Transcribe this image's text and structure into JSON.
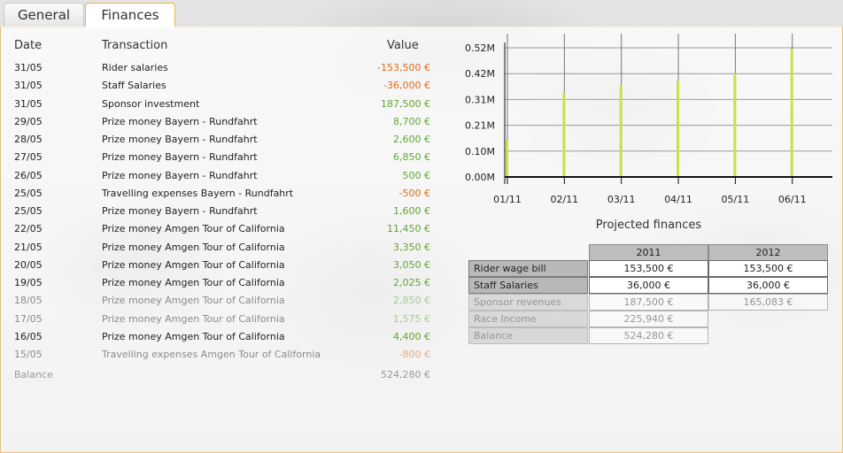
{
  "tabs": [
    {
      "label": "General",
      "active": false
    },
    {
      "label": "Finances",
      "active": true
    }
  ],
  "transactions": {
    "headers": {
      "date": "Date",
      "transaction": "Transaction",
      "value": "Value"
    },
    "rows": [
      {
        "date": "31/05",
        "description": "Rider salaries",
        "value": "-153,500 €",
        "sign": "neg",
        "faded": false
      },
      {
        "date": "31/05",
        "description": "Staff Salaries",
        "value": "-36,000 €",
        "sign": "neg",
        "faded": false
      },
      {
        "date": "31/05",
        "description": "Sponsor investment",
        "value": "187,500 €",
        "sign": "pos",
        "faded": false
      },
      {
        "date": "29/05",
        "description": "Prize money Bayern - Rundfahrt",
        "value": "8,700 €",
        "sign": "pos",
        "faded": false
      },
      {
        "date": "28/05",
        "description": "Prize money Bayern - Rundfahrt",
        "value": "2,600 €",
        "sign": "pos",
        "faded": false
      },
      {
        "date": "27/05",
        "description": "Prize money Bayern - Rundfahrt",
        "value": "6,850 €",
        "sign": "pos",
        "faded": false
      },
      {
        "date": "26/05",
        "description": "Prize money Bayern - Rundfahrt",
        "value": "500 €",
        "sign": "pos",
        "faded": false
      },
      {
        "date": "25/05",
        "description": "Travelling expenses Bayern - Rundfahrt",
        "value": "-500 €",
        "sign": "neg",
        "faded": false
      },
      {
        "date": "25/05",
        "description": "Prize money Bayern - Rundfahrt",
        "value": "1,600 €",
        "sign": "pos",
        "faded": false
      },
      {
        "date": "22/05",
        "description": "Prize money Amgen Tour of California",
        "value": "11,450 €",
        "sign": "pos",
        "faded": false
      },
      {
        "date": "21/05",
        "description": "Prize money Amgen Tour of California",
        "value": "3,350 €",
        "sign": "pos",
        "faded": false
      },
      {
        "date": "20/05",
        "description": "Prize money Amgen Tour of California",
        "value": "3,050 €",
        "sign": "pos",
        "faded": false
      },
      {
        "date": "19/05",
        "description": "Prize money Amgen Tour of California",
        "value": "2,025 €",
        "sign": "pos",
        "faded": false
      },
      {
        "date": "18/05",
        "description": "Prize money Amgen Tour of California",
        "value": "2,850 €",
        "sign": "pos",
        "faded": true
      },
      {
        "date": "17/05",
        "description": "Prize money Amgen Tour of California",
        "value": "1,575 €",
        "sign": "pos",
        "faded": true
      },
      {
        "date": "16/05",
        "description": "Prize money Amgen Tour of California",
        "value": "4,400 €",
        "sign": "pos",
        "faded": false
      },
      {
        "date": "15/05",
        "description": "Travelling expenses Amgen Tour of California",
        "value": "-800 €",
        "sign": "neg",
        "faded": true
      }
    ],
    "balance": {
      "label": "Balance",
      "value": "524,280 €"
    }
  },
  "chart_data": {
    "type": "bar",
    "categories": [
      "01/11",
      "02/11",
      "03/11",
      "04/11",
      "05/11",
      "06/11"
    ],
    "values": [
      0.15,
      0.34,
      0.37,
      0.39,
      0.42,
      0.52
    ],
    "y_ticks": [
      "0.00M",
      "0.10M",
      "0.21M",
      "0.31M",
      "0.42M",
      "0.52M"
    ],
    "ylim": [
      0,
      0.524
    ],
    "bar_color": "#c8e04a",
    "grid": true,
    "unit": "M"
  },
  "projected": {
    "title": "Projected finances",
    "years": [
      "2011",
      "2012"
    ],
    "rows": [
      {
        "label": "Rider wage bill",
        "values": [
          "153,500 €",
          "153,500 €"
        ],
        "faded": false
      },
      {
        "label": "Staff Salaries",
        "values": [
          "36,000 €",
          "36,000 €"
        ],
        "faded": false
      },
      {
        "label": "Sponsor revenues",
        "values": [
          "187,500 €",
          "165,083 €"
        ],
        "faded": true
      },
      {
        "label": "Race Income",
        "values": [
          "225,940 €",
          ""
        ],
        "faded": true
      },
      {
        "label": "Balance",
        "values": [
          "524,280 €",
          ""
        ],
        "faded": true
      }
    ]
  },
  "colors": {
    "positive": "#5fa832",
    "negative": "#e06a1b",
    "accent": "#f0b24a"
  }
}
